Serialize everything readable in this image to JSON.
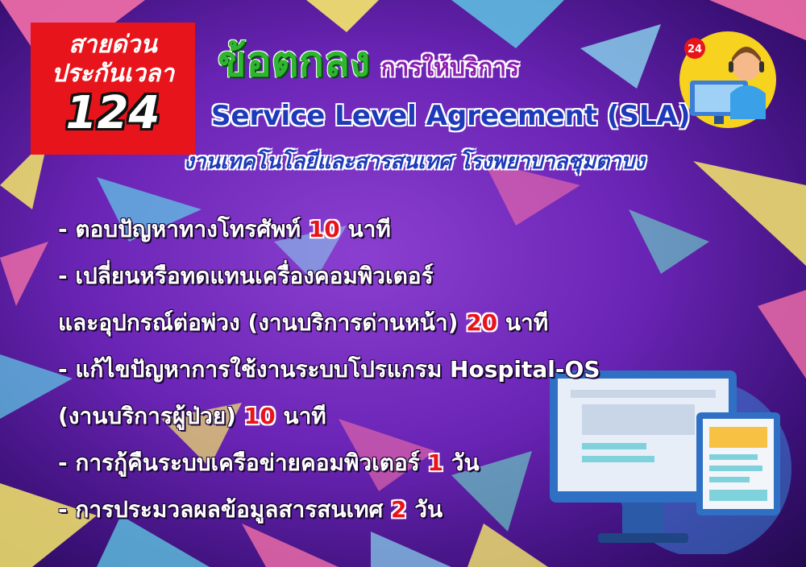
{
  "hotline": {
    "line1": "สายด่วน",
    "line2": "ประกันเวลา",
    "number": "124"
  },
  "title": {
    "thai_big": "ข้อตกลง",
    "thai_small": "การให้บริการ",
    "english": "Service Level Agreement (SLA)"
  },
  "organization": "งานเทคโนโลยีและสารสนเทศ โรงพยาบาลชุมตาบง",
  "badge_24": "24",
  "items": [
    {
      "pre": "- ตอบปัญหาทางโทรศัพท์ ",
      "num": "10",
      "post": " นาที"
    },
    {
      "pre": "- เปลี่ยนหรือทดแทนเครื่องคอมพิวเตอร์",
      "num": "",
      "post": ""
    },
    {
      "pre": "และอุปกรณ์ต่อพ่วง (งานบริการด่านหน้า) ",
      "num": "20",
      "post": " นาที"
    },
    {
      "pre": "- แก้ไขปัญหาการใช้งานระบบโปรแกรม Hospital-OS",
      "num": "",
      "post": ""
    },
    {
      "pre": "(งานบริการผู้ป่วย) ",
      "num": "10",
      "post": " นาที"
    },
    {
      "pre": "- การกู้คืนระบบเครือข่ายคอมพิวเตอร์ ",
      "num": "1",
      "post": " วัน"
    },
    {
      "pre": "- การประมวลผลข้อมูลสารสนเทศ ",
      "num": "2",
      "post": " วัน"
    }
  ]
}
